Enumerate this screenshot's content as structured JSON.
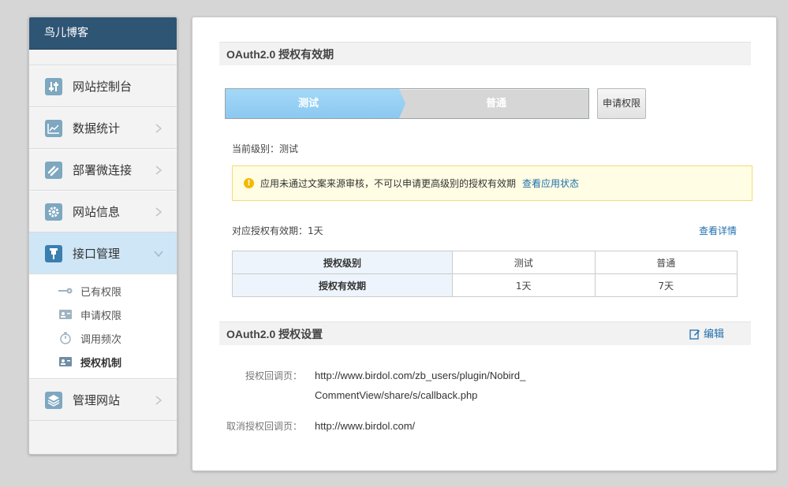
{
  "sidebar": {
    "brand": "鸟儿博客",
    "items": [
      {
        "label": "网站控制台",
        "icon": "sliders-icon"
      },
      {
        "label": "数据统计",
        "icon": "chart-icon"
      },
      {
        "label": "部署微连接",
        "icon": "link-icon"
      },
      {
        "label": "网站信息",
        "icon": "gear-icon"
      },
      {
        "label": "接口管理",
        "icon": "plug-icon"
      },
      {
        "label": "管理网站",
        "icon": "layers-icon"
      }
    ],
    "sub_items": [
      {
        "label": "已有权限",
        "icon": "key-icon"
      },
      {
        "label": "申请权限",
        "icon": "id-card-icon"
      },
      {
        "label": "调用频次",
        "icon": "stopwatch-icon"
      },
      {
        "label": "授权机制",
        "icon": "id-card-icon"
      }
    ]
  },
  "oauth_period": {
    "title": "OAuth2.0 授权有效期",
    "levels": [
      "测试",
      "普通"
    ],
    "current_level_index": 0,
    "apply_button": "申请权限",
    "current_level_text": "当前级别：测试",
    "notice_text": "应用未通过文案来源审核，不可以申请更高级别的授权有效期",
    "notice_link": "查看应用状态",
    "validity_text": "对应授权有效期：1天",
    "details_link": "查看详情",
    "table": {
      "row1": [
        "授权级别",
        "测试",
        "普通"
      ],
      "row2": [
        "授权有效期",
        "1天",
        "7天"
      ]
    }
  },
  "oauth_settings": {
    "title": "OAuth2.0 授权设置",
    "edit_label": "编辑",
    "callback_label": "授权回调页：",
    "callback_value": "http://www.birdol.com/zb_users/plugin/Nobird_CommentView/share/s/callback.php",
    "cancel_label": "取消授权回调页：",
    "cancel_value": "http://www.birdol.com/"
  },
  "colors": {
    "brand_bg": "#2f5575",
    "active_nav_bg": "#cfe6f6",
    "link": "#1f6fae",
    "progress_active": "#8bc8f0"
  }
}
